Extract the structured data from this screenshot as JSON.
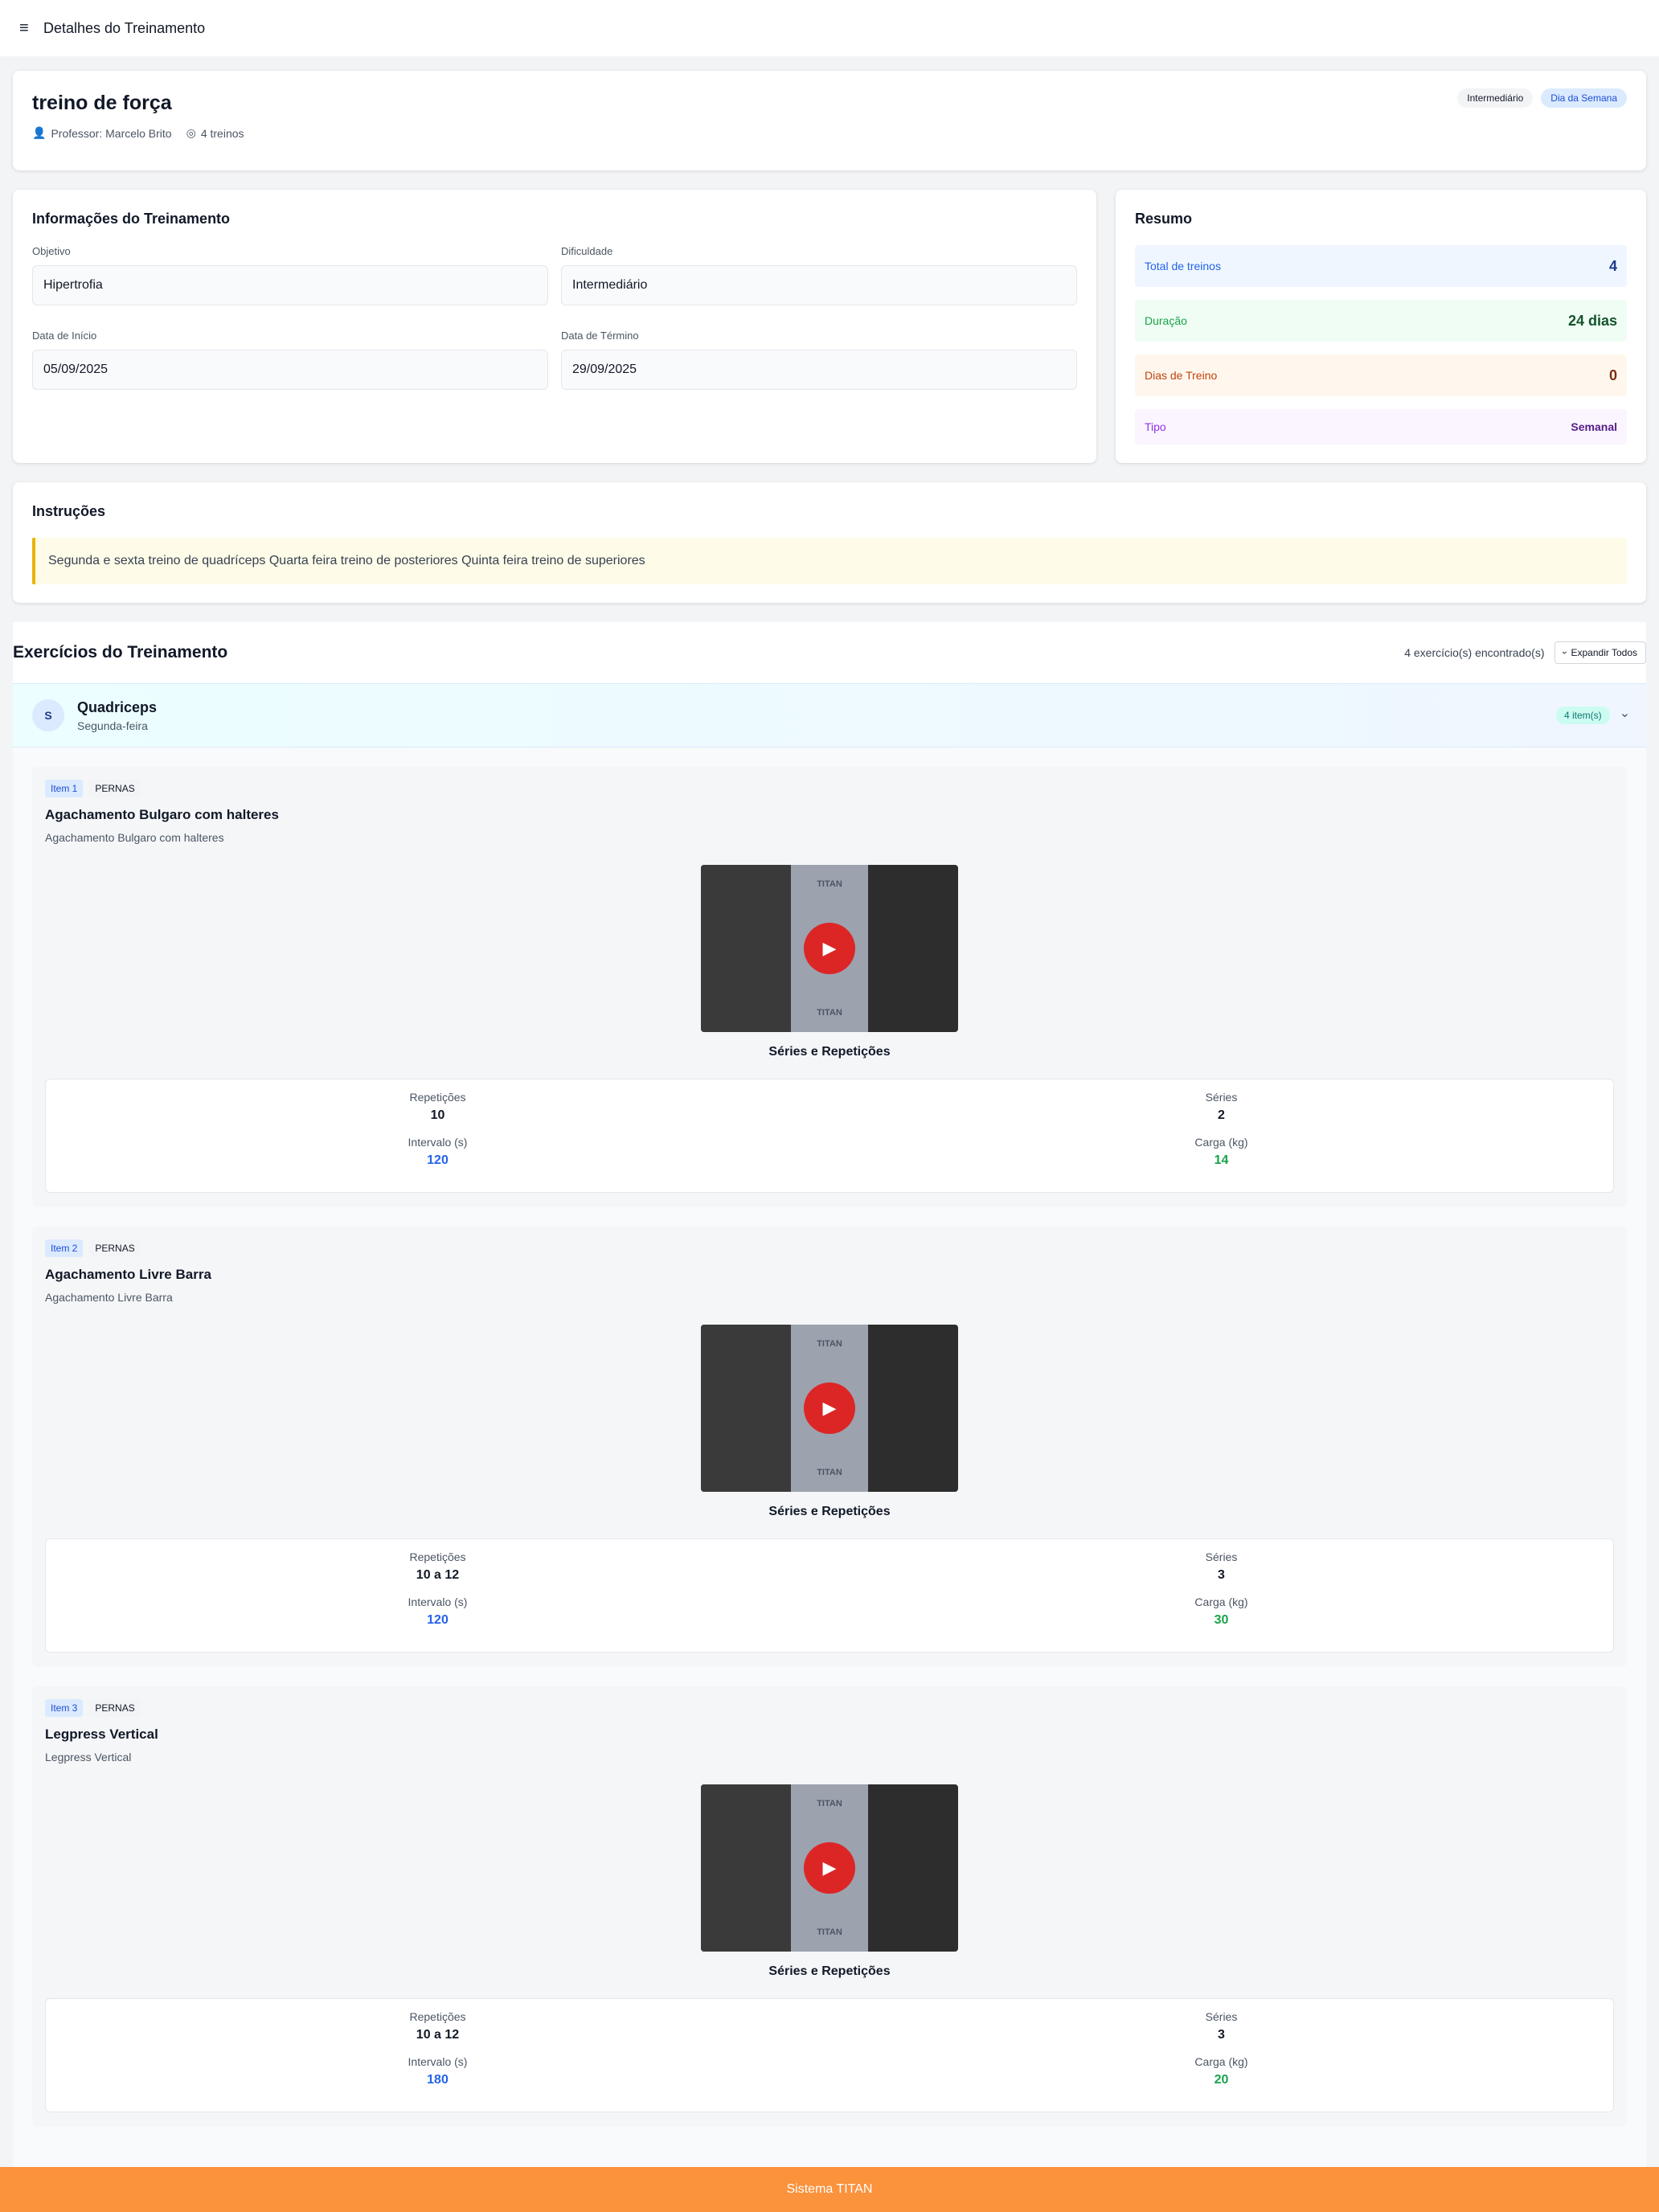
{
  "topbar": {
    "menu_icon": "≡",
    "title": "Detalhes do Treinamento"
  },
  "header": {
    "title": "treino de força",
    "professor": "Professor: Marcelo Brito",
    "trainings": "4 treinos",
    "badges": [
      "Intermediário",
      "Dia da Semana"
    ]
  },
  "info": {
    "title": "Informações do Treinamento",
    "fields": [
      {
        "label": "Objetivo",
        "value": "Hipertrofia"
      },
      {
        "label": "Dificuldade",
        "value": "Intermediário"
      },
      {
        "label": "Data de Início",
        "value": "05/09/2025"
      },
      {
        "label": "Data de Término",
        "value": "29/09/2025"
      }
    ]
  },
  "summary": {
    "title": "Resumo",
    "rows": [
      {
        "label": "Total de treinos",
        "value": "4"
      },
      {
        "label": "Duração",
        "value": "24 dias"
      },
      {
        "label": "Dias de Treino",
        "value": "0"
      },
      {
        "label": "Tipo",
        "value": "Semanal"
      }
    ],
    "colors": {
      "blue": "#2563eb",
      "green": "#16a34a",
      "orange": "#c2410c",
      "purple": "#9333ea"
    }
  },
  "instructions": {
    "title": "Instruções",
    "text": "Segunda e sexta treino de quadríceps Quarta feira treino de posteriores Quinta feira treino de superiores"
  },
  "exercises": {
    "title": "Exercícios do Treinamento",
    "found": "4 exercício(s) encontrado(s)",
    "expand_label": "Expandir Todos",
    "group": {
      "avatar": "S",
      "name": "Quadriceps",
      "day": "Segunda-feira",
      "count": "4 item(s)"
    },
    "items": [
      {
        "tag": "Item 1",
        "category": "PERNAS",
        "name": "Agachamento Bulgaro com halteres",
        "desc": "Agachamento Bulgaro com halteres",
        "watermark": "TITAN",
        "section": "Séries e Repetições",
        "stats": {
          "rep_label": "Repetições",
          "rep": "10",
          "series_label": "Séries",
          "series": "2",
          "interval_label": "Intervalo (s)",
          "interval": "120",
          "load_label": "Carga (kg)",
          "load": "14"
        }
      },
      {
        "tag": "Item 2",
        "category": "PERNAS",
        "name": "Agachamento Livre Barra",
        "desc": "Agachamento Livre Barra",
        "watermark": "TITAN",
        "section": "Séries e Repetições",
        "stats": {
          "rep_label": "Repetições",
          "rep": "10 a 12",
          "series_label": "Séries",
          "series": "3",
          "interval_label": "Intervalo (s)",
          "interval": "120",
          "load_label": "Carga (kg)",
          "load": "30"
        }
      },
      {
        "tag": "Item 3",
        "category": "PERNAS",
        "name": "Legpress Vertical",
        "desc": "Legpress Vertical",
        "watermark": "TITAN",
        "section": "Séries e Repetições",
        "stats": {
          "rep_label": "Repetições",
          "rep": "10 a 12",
          "series_label": "Séries",
          "series": "3",
          "interval_label": "Intervalo (s)",
          "interval": "180",
          "load_label": "Carga (kg)",
          "load": "20"
        }
      }
    ]
  },
  "footer": {
    "text": "Sistema TITAN",
    "color": "#fb923c"
  }
}
